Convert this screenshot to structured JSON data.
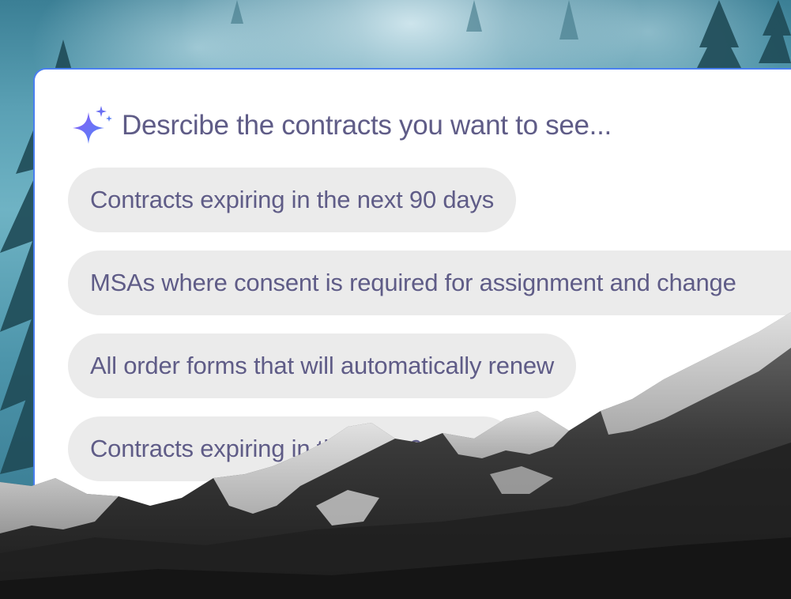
{
  "search": {
    "prompt": "Desrcibe the contracts you want to see..."
  },
  "suggestions": [
    {
      "label": "Contracts expiring in the next 90 days"
    },
    {
      "label": "MSAs where consent is required for assignment and change"
    },
    {
      "label": "All order forms that will automatically renew"
    },
    {
      "label": "Contracts expiring in the next 90 days"
    }
  ],
  "colors": {
    "accent": "#4a7ff0",
    "text": "#5f5c87",
    "chip_background": "#ebebeb",
    "sparkle_start": "#7a5cf0",
    "sparkle_end": "#4f86f7"
  },
  "icons": {
    "prompt_icon": "sparkle-icon"
  }
}
